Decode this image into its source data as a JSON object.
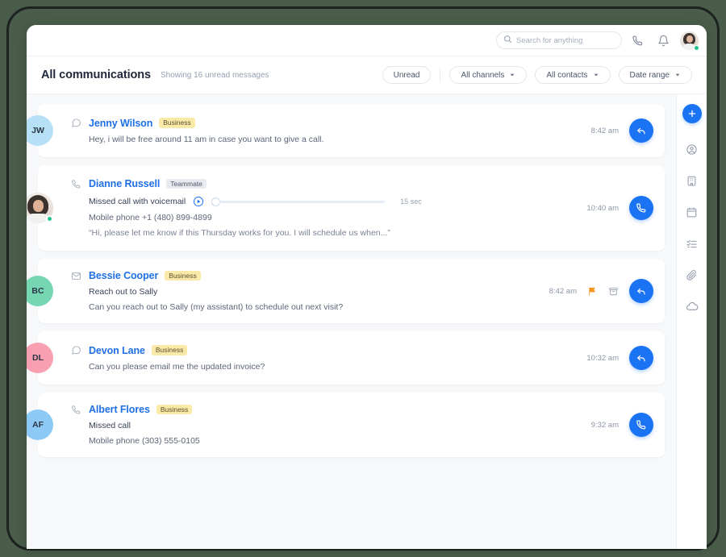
{
  "topbar": {
    "search": {
      "placeholder": "Search for anything",
      "value": ""
    },
    "call_icon": "phone-icon",
    "bell_icon": "bell-icon",
    "avatar": "user-avatar"
  },
  "header": {
    "title": "All communications",
    "subtitle": "Showing 16 unread messages",
    "filters": [
      {
        "label": "Unread",
        "caret": false
      },
      {
        "label": "All channels",
        "caret": true
      },
      {
        "label": "All contacts",
        "caret": true
      },
      {
        "label": "Date range",
        "caret": true
      }
    ]
  },
  "messages": [
    {
      "initials": "JW",
      "avatar_color": "#b5e0f5",
      "avatar_type": "initials",
      "channel_icon": "chat-bubble-icon",
      "name": "Jenny Wilson",
      "tag": "Business",
      "tag_type": "business",
      "lines": [
        "Hey, i will be free around 11 am in case you want to give a call."
      ],
      "time": "8:42 am",
      "action_icon": "reply-icon",
      "extra_icons": []
    },
    {
      "initials": "",
      "avatar_color": "#ece5df",
      "avatar_type": "photo",
      "channel_icon": "phone-icon",
      "name": "Dianne Russell",
      "tag": "Teammate",
      "tag_type": "teammate",
      "voicemail": {
        "label": "Missed call with voicemail",
        "duration": "15 sec",
        "progress": 0
      },
      "lines": [
        "Mobile phone +1 (480) 899-4899",
        "“Hi, please let me know if this Thursday works for you. I will schedule us when...”"
      ],
      "time": "10:40 am",
      "action_icon": "phone-icon",
      "extra_icons": []
    },
    {
      "initials": "BC",
      "avatar_color": "#76d6b4",
      "avatar_type": "initials",
      "channel_icon": "envelope-icon",
      "name": "Bessie Cooper",
      "tag": "Business",
      "tag_type": "business",
      "lines": [
        "Reach out to Sally",
        "Can you reach out to Sally (my assistant) to schedule out next visit?"
      ],
      "time": "8:42 am",
      "action_icon": "reply-icon",
      "extra_icons": [
        "flag-icon",
        "archive-icon"
      ]
    },
    {
      "initials": "DL",
      "avatar_color": "#f8a0b1",
      "avatar_type": "initials",
      "channel_icon": "chat-bubble-icon",
      "name": "Devon Lane",
      "tag": "Business",
      "tag_type": "business",
      "lines": [
        "Can you please email me the updated invoice?"
      ],
      "time": "10:32 am",
      "action_icon": "reply-icon",
      "extra_icons": []
    },
    {
      "initials": "AF",
      "avatar_color": "#8dc9f5",
      "avatar_type": "initials",
      "channel_icon": "phone-icon",
      "name": "Albert Flores",
      "tag": "Business",
      "tag_type": "business",
      "lines": [
        "Missed call",
        "Mobile phone (303) 555-0105"
      ],
      "time": "9:32 am",
      "action_icon": "phone-icon",
      "extra_icons": []
    }
  ],
  "rail": {
    "add_label": "+",
    "items": [
      "contact-icon",
      "building-icon",
      "calendar-icon",
      "checklist-icon",
      "paperclip-icon",
      "cloud-icon"
    ]
  },
  "colors": {
    "accent": "#1a73f2",
    "name_blue": "#1f6fe5",
    "tag_yellow": "#fbe9a8",
    "flag_orange": "#f7941e",
    "online_green": "#22c58b",
    "page_bg": "#f6f8fa",
    "frame": "#4a5d4a"
  }
}
